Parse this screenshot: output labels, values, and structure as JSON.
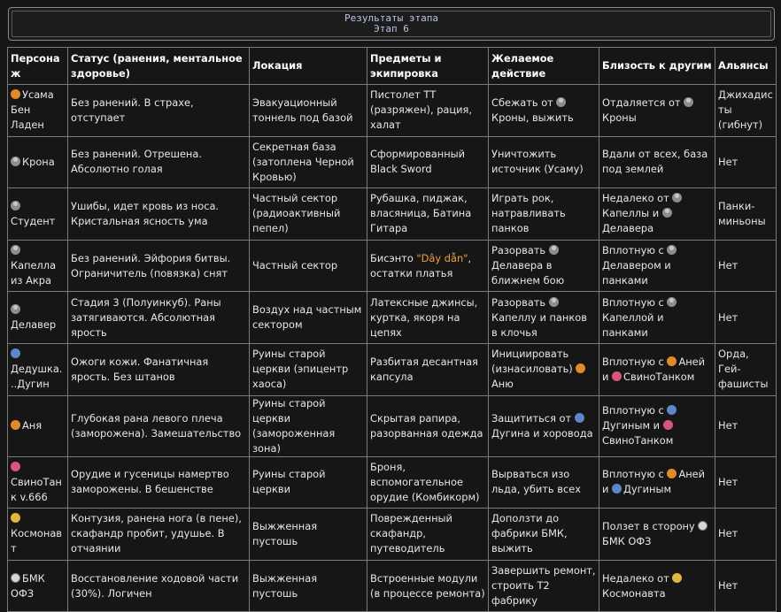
{
  "header": {
    "line1": "Результаты этапа",
    "line2": "Этап 6"
  },
  "columns": [
    "Персонаж",
    "Статус (ранения, ментальное здоровье)",
    "Локация",
    "Предметы и экипировка",
    "Желаемое действие",
    "Близость к другим",
    "Альянсы"
  ],
  "rows": [
    {
      "character": {
        "icon": "orange",
        "text": "Усама Бен Ладен"
      },
      "status": "Без ранений. В страхе, отступает",
      "location": "Эвакуационный тоннель под базой",
      "items": "Пистолет ТТ (разряжен), рация, халат",
      "action_parts": [
        {
          "t": "Сбежать от "
        },
        {
          "icon": "gray"
        },
        {
          "t": "Кроны, выжить"
        }
      ],
      "proximity_parts": [
        {
          "t": "Отдаляется от "
        },
        {
          "icon": "gray"
        },
        {
          "t": "Кроны"
        }
      ],
      "alliance": "Джихадисты (гибнут)"
    },
    {
      "character": {
        "icon": "gray",
        "text": "Крона"
      },
      "status": "Без ранений. Отрешена. Абсолютно голая",
      "location": "Секретная база (затоплена Черной Кровью)",
      "items": "Сформированный Black Sword",
      "action_parts": [
        {
          "t": "Уничтожить источник (Усаму)"
        }
      ],
      "proximity_parts": [
        {
          "t": "Вдали от всех, база под землей"
        }
      ],
      "alliance": "Нет"
    },
    {
      "character": {
        "icon": "gray",
        "text": "Студент"
      },
      "status": "Ушибы, идет кровь из носа. Кристальная ясность ума",
      "location": "Частный сектор (радиоактивный пепел)",
      "items": "Рубашка, пиджак, власяница, Батина Гитара",
      "action_parts": [
        {
          "t": "Играть рок, натравливать панков"
        }
      ],
      "proximity_parts": [
        {
          "t": "Недалеко от "
        },
        {
          "icon": "gray"
        },
        {
          "t": "Капеллы и "
        },
        {
          "icon": "gray"
        },
        {
          "t": "Делавера"
        }
      ],
      "alliance": "Панки-миньоны"
    },
    {
      "character": {
        "icon": "gray",
        "text": "Капелла из Акра"
      },
      "status": "Без ранений. Эйфория битвы. Ограничитель (повязка) снят",
      "location": "Частный сектор",
      "items_parts": [
        {
          "t": "Бисэнто "
        },
        {
          "hl": "\"Dây dẫn\""
        },
        {
          "t": ", остатки платья"
        }
      ],
      "action_parts": [
        {
          "t": "Разорвать "
        },
        {
          "icon": "gray"
        },
        {
          "t": "Делавера в ближнем бою"
        }
      ],
      "proximity_parts": [
        {
          "t": "Вплотную с "
        },
        {
          "icon": "gray"
        },
        {
          "t": "Делавером и панками"
        }
      ],
      "alliance": "Нет"
    },
    {
      "character": {
        "icon": "gray",
        "text": "Делавер"
      },
      "status": "Стадия 3 (Полуинкуб). Раны затягиваются. Абсолютная ярость",
      "location": "Воздух над частным сектором",
      "items": "Латексные джинсы, куртка, якоря на цепях",
      "action_parts": [
        {
          "t": "Разорвать "
        },
        {
          "icon": "gray"
        },
        {
          "t": "Капеллу и панков в клочья"
        }
      ],
      "proximity_parts": [
        {
          "t": "Вплотную с "
        },
        {
          "icon": "gray"
        },
        {
          "t": "Капеллой и панками"
        }
      ],
      "alliance": "Нет"
    },
    {
      "character": {
        "icon": "blue",
        "text": "Дедушка...Дугин"
      },
      "status": "Ожоги кожи. Фанатичная ярость. Без штанов",
      "location": "Руины старой церкви (эпицентр хаоса)",
      "items": "Разбитая десантная капсула",
      "action_parts": [
        {
          "t": "Инициировать (изнасиловать) "
        },
        {
          "icon": "orange"
        },
        {
          "t": "Аню"
        }
      ],
      "proximity_parts": [
        {
          "t": "Вплотную с "
        },
        {
          "icon": "orange"
        },
        {
          "t": "Аней и "
        },
        {
          "icon": "pink"
        },
        {
          "t": "СвиноТанком"
        }
      ],
      "alliance": "Орда, Гей-фашисты"
    },
    {
      "character": {
        "icon": "orange",
        "text": "Аня"
      },
      "status": "Глубокая рана левого плеча (заморожена). Замешательство",
      "location": "Руины старой церкви (замороженная зона)",
      "items": "Скрытая рапира, разорванная одежда",
      "action_parts": [
        {
          "t": "Защититься от "
        },
        {
          "icon": "blue"
        },
        {
          "t": "Дугина и хоровода"
        }
      ],
      "proximity_parts": [
        {
          "t": "Вплотную с "
        },
        {
          "icon": "blue"
        },
        {
          "t": "Дугиным и "
        },
        {
          "icon": "pink"
        },
        {
          "t": "СвиноТанком"
        }
      ],
      "alliance": "Нет"
    },
    {
      "character": {
        "icon": "pink",
        "text": "СвиноТанк v.666"
      },
      "status": "Орудие и гусеницы намертво заморожены. В бешенстве",
      "location": "Руины старой церкви",
      "items": "Броня, вспомогательное орудие (Комбикорм)",
      "action_parts": [
        {
          "t": "Вырваться изо льда, убить всех"
        }
      ],
      "proximity_parts": [
        {
          "t": "Вплотную с "
        },
        {
          "icon": "orange"
        },
        {
          "t": "Аней и "
        },
        {
          "icon": "blue"
        },
        {
          "t": "Дугиным"
        }
      ],
      "alliance": "Нет"
    },
    {
      "character": {
        "icon": "yellow",
        "text": "Космонавт"
      },
      "status": "Контузия, ранена нога (в пене), скафандр пробит, удушье. В отчаянии",
      "location": "Выжженная пустошь",
      "items": "Поврежденный скафандр, путеводитель",
      "action_parts": [
        {
          "t": "Доползти до фабрики БМК, выжить"
        }
      ],
      "proximity_parts": [
        {
          "t": "Ползет в сторону "
        },
        {
          "icon": "white"
        },
        {
          "t": "БМК ОФЗ"
        }
      ],
      "alliance": "Нет"
    },
    {
      "character": {
        "icon": "white",
        "text": "БМК ОФЗ"
      },
      "status": "Восстановление ходовой части (30%). Логичен",
      "location": "Выжженная пустошь",
      "items": "Встроенные модули (в процессе ремонта)",
      "action_parts": [
        {
          "t": "Завершить ремонт, строить Т2 фабрику"
        }
      ],
      "proximity_parts": [
        {
          "t": "Недалеко от "
        },
        {
          "icon": "yellow"
        },
        {
          "t": "Космонавта"
        }
      ],
      "alliance": "Нет"
    }
  ]
}
